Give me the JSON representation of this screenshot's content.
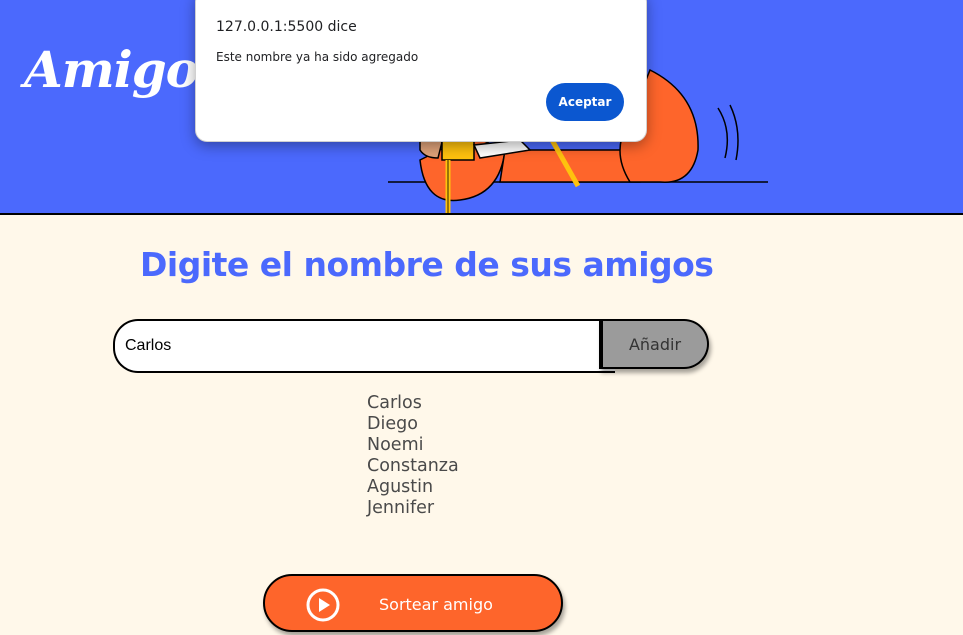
{
  "header": {
    "title": "Amigo S",
    "background_color": "#4b69fd",
    "illustration": "person-reading-illustration"
  },
  "main": {
    "section_title": "Digite el nombre de sus amigos",
    "name_input": {
      "value": "Carlos",
      "placeholder": ""
    },
    "add_button_label": "Añadir",
    "friends": [
      "Carlos",
      "Diego",
      "Noemi",
      "Constanza",
      "Agustin",
      "Jennifer"
    ],
    "draw_button": {
      "label": "Sortear amigo",
      "icon": "play-circle-icon"
    },
    "accent_color": "#fe652b",
    "background_color": "#fff8ea"
  },
  "alert": {
    "origin": "127.0.0.1:5500 dice",
    "message": "Este nombre ya ha sido agregado",
    "ok_label": "Aceptar",
    "button_color": "#0b57d0"
  }
}
